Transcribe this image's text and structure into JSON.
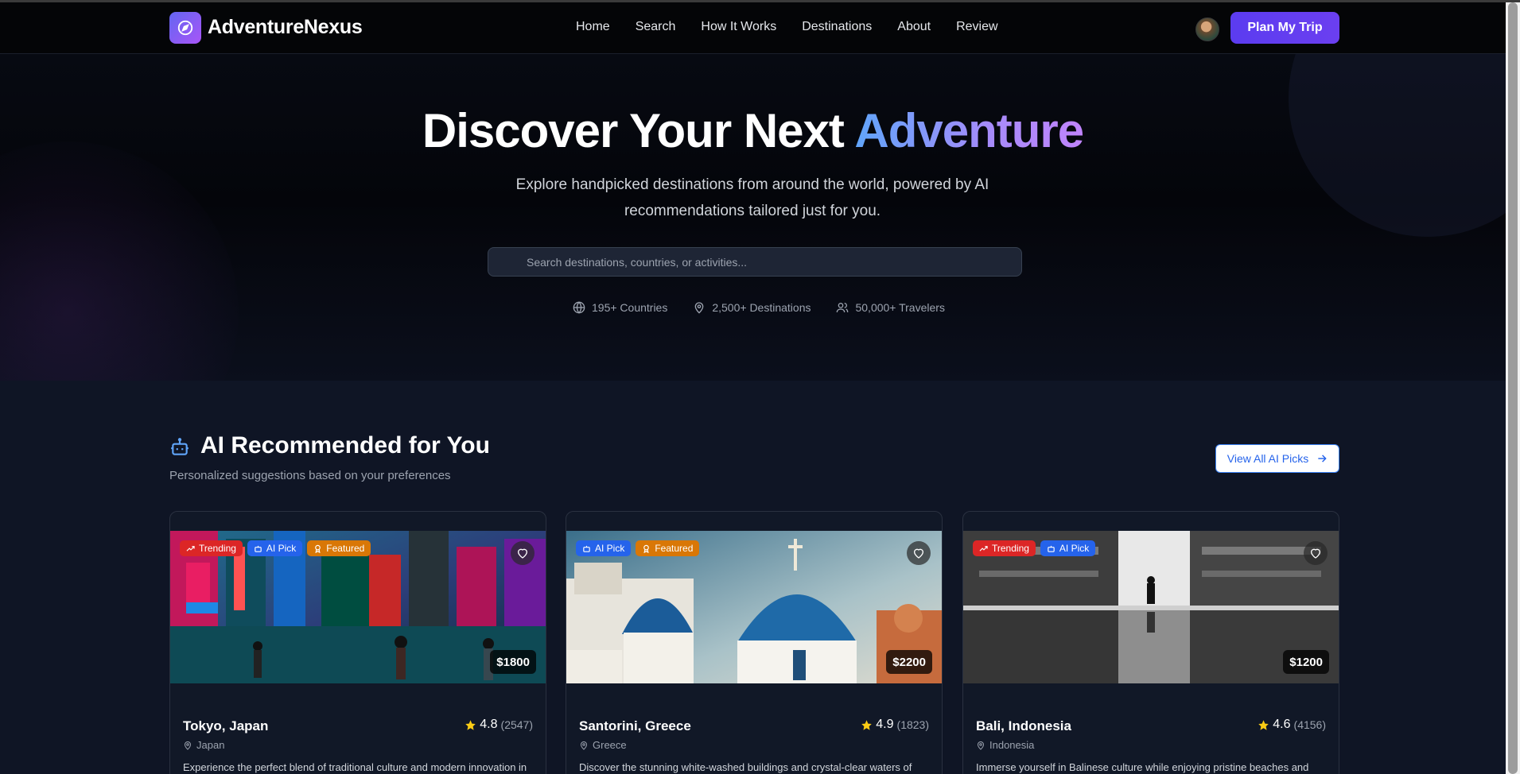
{
  "brand": {
    "name": "AdventureNexus"
  },
  "nav": {
    "links": [
      "Home",
      "Search",
      "How It Works",
      "Destinations",
      "About",
      "Review"
    ],
    "cta": "Plan My Trip"
  },
  "hero": {
    "title_main": "Discover Your Next ",
    "title_accent": "Adventure",
    "subtitle": "Explore handpicked destinations from around the world, powered by AI recommendations tailored just for you.",
    "search_placeholder": "Search destinations, countries, or activities...",
    "stats": [
      {
        "icon": "globe-icon",
        "label": "195+ Countries"
      },
      {
        "icon": "map-pin-icon",
        "label": "2,500+ Destinations"
      },
      {
        "icon": "users-icon",
        "label": "50,000+ Travelers"
      }
    ]
  },
  "section": {
    "title": "AI Recommended for You",
    "subtitle": "Personalized suggestions based on your preferences",
    "view_all": "View All AI Picks"
  },
  "cards": [
    {
      "name": "Tokyo, Japan",
      "country": "Japan",
      "rating": "4.8",
      "reviews": "(2547)",
      "price": "$1800",
      "tags": [
        "Trending",
        "AI Pick",
        "Featured"
      ],
      "description": "Experience the perfect blend of traditional culture and modern innovation in"
    },
    {
      "name": "Santorini, Greece",
      "country": "Greece",
      "rating": "4.9",
      "reviews": "(1823)",
      "price": "$2200",
      "tags": [
        "AI Pick",
        "Featured"
      ],
      "description": "Discover the stunning white-washed buildings and crystal-clear waters of"
    },
    {
      "name": "Bali, Indonesia",
      "country": "Indonesia",
      "rating": "4.6",
      "reviews": "(4156)",
      "price": "$1200",
      "tags": [
        "Trending",
        "AI Pick"
      ],
      "description": "Immerse yourself in Balinese culture while enjoying pristine beaches and"
    }
  ],
  "colors": {
    "accent": "#6366f1",
    "trending": "#dc2626",
    "ai_pick": "#2563eb",
    "featured": "#d97706",
    "star": "#facc15"
  }
}
